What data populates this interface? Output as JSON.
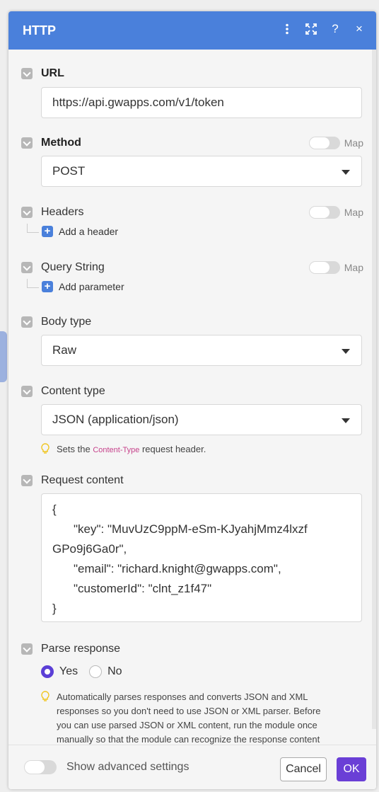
{
  "header": {
    "title": "HTTP",
    "icons": [
      "kebab-menu-icon",
      "expand-icon",
      "help-icon",
      "close-icon"
    ],
    "help_label": "?",
    "close_label": "×",
    "color": "#4a80db"
  },
  "url": {
    "label": "URL",
    "value": "https://api.gwapps.com/v1/token"
  },
  "method": {
    "label": "Method",
    "map_label": "Map",
    "value": "POST"
  },
  "headers": {
    "label": "Headers",
    "map_label": "Map",
    "add_label": "Add a header"
  },
  "query_string": {
    "label": "Query String",
    "map_label": "Map",
    "add_label": "Add parameter"
  },
  "body_type": {
    "label": "Body type",
    "value": "Raw"
  },
  "content_type": {
    "label": "Content type",
    "value": "JSON (application/json)",
    "hint_prefix": "Sets the ",
    "hint_code": "Content-Type",
    "hint_suffix": " request header."
  },
  "request_content": {
    "label": "Request content",
    "lines": [
      "{",
      "\"key\": \"MuvUzC9ppM-eSm-KJyahjMmz4lxzf",
      "GPo9j6Ga0r\",",
      "\"email\": \"richard.knight@gwapps.com\",",
      "\"customerId\": \"clnt_z1f47\"",
      "}"
    ]
  },
  "parse_response": {
    "label": "Parse response",
    "options": [
      "Yes",
      "No"
    ],
    "selected": "Yes",
    "hint_lines": [
      "Automatically parses responses and converts JSON and XML",
      "responses so you don't need to use JSON or XML parser. Before",
      "you can use parsed JSON or XML content, run the module once",
      "manually so that the module can recognize the response content"
    ]
  },
  "footer": {
    "advanced_label": "Show advanced settings",
    "cancel_label": "Cancel",
    "ok_label": "OK",
    "ok_color": "#6a3fd6"
  }
}
